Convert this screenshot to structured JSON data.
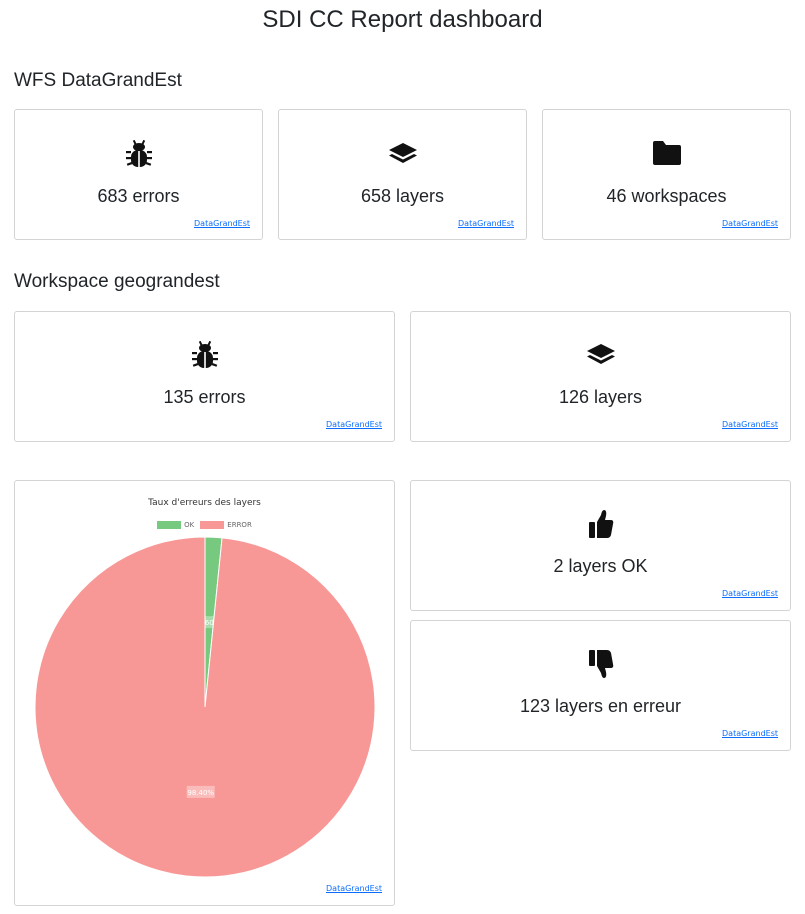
{
  "page": {
    "title": "SDI CC Report dashboard"
  },
  "sections": {
    "wfs": {
      "title": "WFS DataGrandEst",
      "cards": [
        {
          "icon": "bug-icon",
          "text": "683 errors",
          "link": "DataGrandEst"
        },
        {
          "icon": "layers-icon",
          "text": "658 layers",
          "link": "DataGrandEst"
        },
        {
          "icon": "folder-icon",
          "text": "46 workspaces",
          "link": "DataGrandEst"
        }
      ]
    },
    "workspace": {
      "title": "Workspace geograndest",
      "cards": [
        {
          "icon": "bug-icon",
          "text": "135 errors",
          "link": "DataGrandEst"
        },
        {
          "icon": "layers-icon",
          "text": "126 layers",
          "link": "DataGrandEst"
        }
      ]
    },
    "status": {
      "cards": [
        {
          "icon": "thumbs-up-icon",
          "text": "2 layers OK",
          "link": "DataGrandEst"
        },
        {
          "icon": "thumbs-down-icon",
          "text": "123 layers en erreur",
          "link": "DataGrandEst"
        }
      ],
      "chart_link": "DataGrandEst"
    }
  },
  "colors": {
    "ok": "#77c97f",
    "error": "#f79896",
    "link": "#0d6efd",
    "border": "#d4d4d4"
  },
  "chart_data": {
    "type": "pie",
    "title": "Taux d'erreurs des layers",
    "categories": [
      "OK",
      "ERROR"
    ],
    "values": [
      1.6,
      98.4
    ],
    "labels": [
      "1.60%",
      "98.40%"
    ],
    "legend": "top"
  }
}
